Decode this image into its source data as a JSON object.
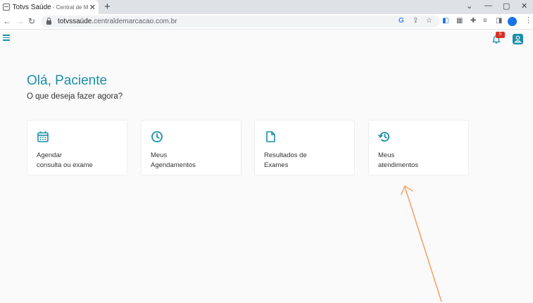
{
  "browser": {
    "tab_title_main": "Totvs Saúde",
    "tab_title_rest": "- Central de Marca",
    "tab_close": "✕",
    "new_tab": "+",
    "url_host": "totvssaúde.",
    "url_rest": "centraldemarcacao.com.br",
    "window_controls": [
      "⌄",
      "—",
      "▢",
      "✕"
    ]
  },
  "app": {
    "notification_count": "5",
    "greeting": "Olá, Paciente",
    "subtitle": "O que deseja fazer agora?",
    "accent_color": "#1b8ea8",
    "cards": [
      {
        "line1": "Agendar",
        "line2": "consulta ou exame",
        "icon": "calendar-icon"
      },
      {
        "line1": "Meus",
        "line2": "Agendamentos",
        "icon": "clock-icon"
      },
      {
        "line1": "Resultados de",
        "line2": "Exames",
        "icon": "document-icon"
      },
      {
        "line1": "Meus",
        "line2": "atendimentos",
        "icon": "history-icon"
      }
    ]
  },
  "annotation": {
    "arrow_color": "#f4a46a"
  }
}
